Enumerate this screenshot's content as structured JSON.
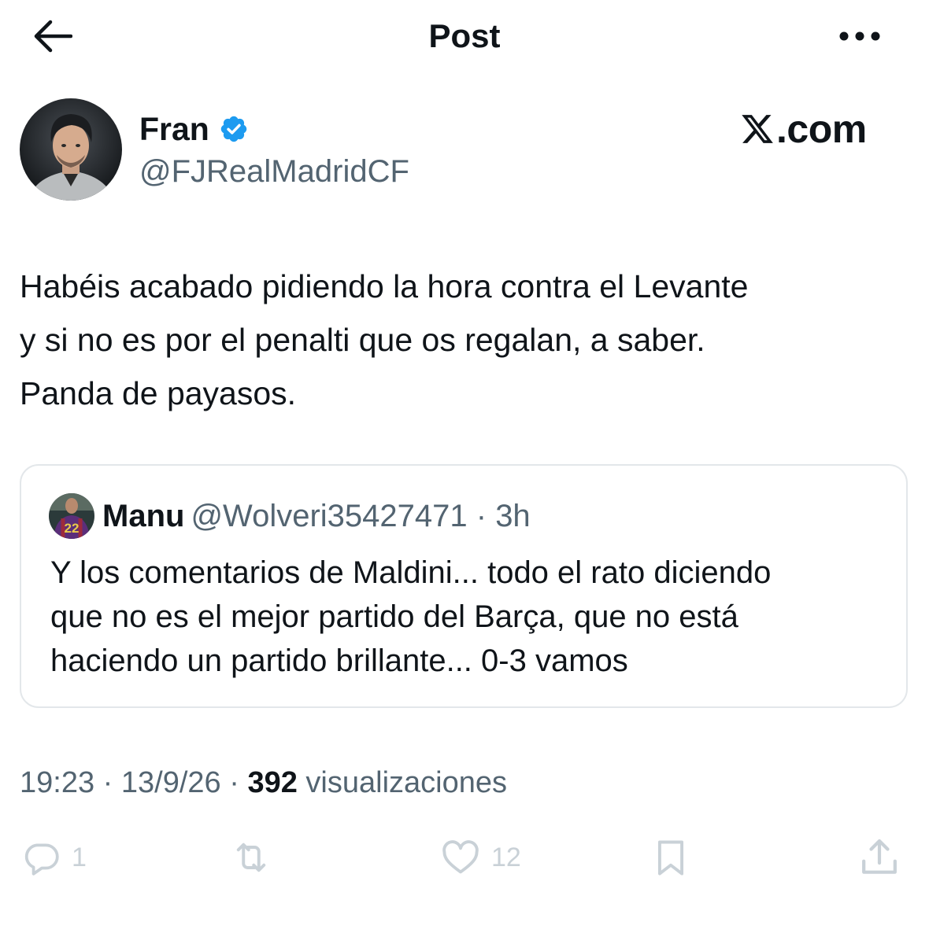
{
  "header": {
    "back_icon": "arrow-left-icon",
    "title": "Post",
    "more_icon": "more-horizontal-icon"
  },
  "author": {
    "name": "Fran",
    "handle": "@FJRealMadridCF",
    "verified_icon": "verified-badge-icon",
    "verified_color": "#1d9bf0"
  },
  "watermark": {
    "text": ".com",
    "logo_icon": "x-logo-icon"
  },
  "tweet": {
    "text": "Habéis acabado pidiendo la hora contra el Levante\ny si no es por el penalti que os regalan, a saber.\nPanda de payasos."
  },
  "quote": {
    "name": "Manu",
    "handle": "@Wolveri35427471",
    "separator": " · ",
    "time": "3h",
    "avatar_number": "22",
    "text": "Y los comentarios de Maldini... todo el rato diciendo\nque no es el mejor partido del Barça, que no está\nhaciendo un partido brillante... 0-3 vamos"
  },
  "meta": {
    "time": "19:23",
    "separator": " · ",
    "date": "13/9/26",
    "views_count": "392",
    "views_label": "visualizaciones"
  },
  "actions": {
    "reply_icon": "reply-icon",
    "reply_count": "1",
    "repost_icon": "repost-icon",
    "repost_count": "",
    "like_icon": "heart-icon",
    "like_count": "12",
    "bookmark_icon": "bookmark-icon",
    "share_icon": "share-icon"
  },
  "colors": {
    "text_primary": "#0f1419",
    "text_secondary": "#536471",
    "border": "#e3e7ea",
    "action_icons": "#c9d1d7"
  }
}
